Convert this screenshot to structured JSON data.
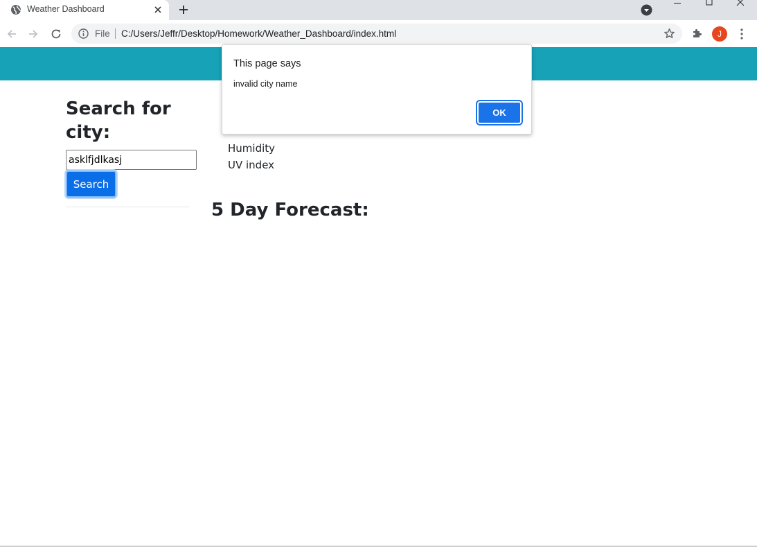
{
  "browser": {
    "tab_title": "Weather Dashboard",
    "file_label": "File",
    "url": "C:/Users/Jeffr/Desktop/Homework/Weather_Dashboard/index.html",
    "profile_initial": "J",
    "profile_color": "#e8461e",
    "icons": [
      "globe-icon",
      "close-icon",
      "plus-icon",
      "tab-search-icon",
      "back-icon",
      "forward-icon",
      "reload-icon",
      "info-icon",
      "star-icon",
      "extensions-icon",
      "kebab-menu-icon"
    ]
  },
  "page": {
    "header_color": "#17a2b8",
    "sidebar": {
      "heading": "Search for city:",
      "search_value": "asklfjdlkasj",
      "search_button": "Search"
    },
    "weather": {
      "humidity_label": "Humidity",
      "uv_label": "UV index"
    },
    "forecast_heading": "5 Day Forecast:"
  },
  "alert": {
    "title": "This page says",
    "message": "invalid city name",
    "ok_label": "OK",
    "ok_color": "#1a73e8"
  }
}
